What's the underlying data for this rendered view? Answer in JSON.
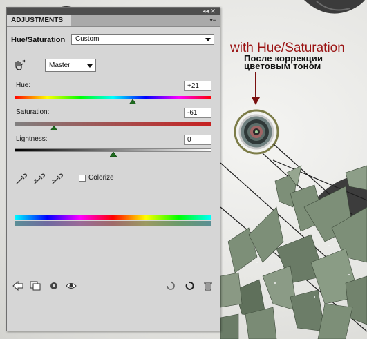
{
  "annotation": {
    "title": "with Hue/Saturation",
    "line1": "После коррекции",
    "line2": "цветовым тоном"
  },
  "panel": {
    "header": "ADJUSTMENTS",
    "title_controls": "◂◂ ✕",
    "menu_icon": "menu-icon",
    "adjustment_name": "Hue/Saturation",
    "preset": {
      "value": "Custom"
    },
    "channel": {
      "value": "Master"
    },
    "sliders": [
      {
        "label": "Hue:",
        "value": "+21",
        "position": 0.6
      },
      {
        "label": "Saturation:",
        "value": "-61",
        "position": 0.2
      },
      {
        "label": "Lightness:",
        "value": "0",
        "position": 0.5
      }
    ],
    "colorize_label": "Colorize",
    "colorize_checked": false,
    "bottom_icons": [
      "back-arrow-icon",
      "clip-layer-icon",
      "view-previous-icon",
      "visibility-eye-icon",
      "reset-icon",
      "refresh-icon",
      "trash-icon"
    ]
  },
  "colors": {
    "annotation_red": "#9b1414",
    "titlebar": "#4e4e4e",
    "panel_bg": "#d6d6d6",
    "shard_green": "#7d8f78"
  }
}
